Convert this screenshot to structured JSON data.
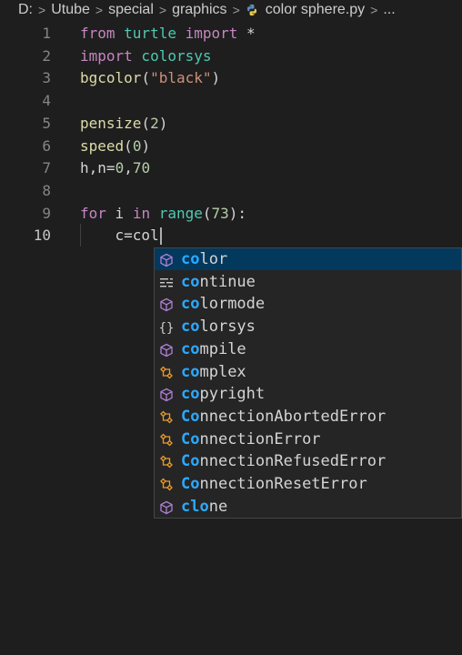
{
  "breadcrumb": {
    "items": [
      "D:",
      "Utube",
      "special",
      "graphics",
      "color sphere.py",
      "..."
    ]
  },
  "editor": {
    "lines": [
      {
        "num": "1",
        "tokens": [
          {
            "t": "from",
            "c": "kw"
          },
          {
            "t": " turtle ",
            "c": "mod"
          },
          {
            "t": "import",
            "c": "kw"
          },
          {
            "t": " *",
            "c": "plain"
          }
        ]
      },
      {
        "num": "2",
        "tokens": [
          {
            "t": "import",
            "c": "kw"
          },
          {
            "t": " colorsys",
            "c": "mod"
          }
        ]
      },
      {
        "num": "3",
        "tokens": [
          {
            "t": "bgcolor",
            "c": "fn"
          },
          {
            "t": "(",
            "c": "plain"
          },
          {
            "t": "\"black\"",
            "c": "str"
          },
          {
            "t": ")",
            "c": "plain"
          }
        ]
      },
      {
        "num": "4",
        "tokens": []
      },
      {
        "num": "5",
        "tokens": [
          {
            "t": "pensize",
            "c": "fn"
          },
          {
            "t": "(",
            "c": "plain"
          },
          {
            "t": "2",
            "c": "num"
          },
          {
            "t": ")",
            "c": "plain"
          }
        ]
      },
      {
        "num": "6",
        "tokens": [
          {
            "t": "speed",
            "c": "fn"
          },
          {
            "t": "(",
            "c": "plain"
          },
          {
            "t": "0",
            "c": "num"
          },
          {
            "t": ")",
            "c": "plain"
          }
        ]
      },
      {
        "num": "7",
        "tokens": [
          {
            "t": "h",
            "c": "plain"
          },
          {
            "t": ",",
            "c": "plain"
          },
          {
            "t": "n",
            "c": "plain"
          },
          {
            "t": "=",
            "c": "plain"
          },
          {
            "t": "0",
            "c": "num"
          },
          {
            "t": ",",
            "c": "plain"
          },
          {
            "t": "70",
            "c": "num"
          }
        ]
      },
      {
        "num": "8",
        "tokens": []
      },
      {
        "num": "9",
        "tokens": [
          {
            "t": "for",
            "c": "kw"
          },
          {
            "t": " i ",
            "c": "plain"
          },
          {
            "t": "in",
            "c": "kw"
          },
          {
            "t": " ",
            "c": "plain"
          },
          {
            "t": "range",
            "c": "mod"
          },
          {
            "t": "(",
            "c": "plain"
          },
          {
            "t": "73",
            "c": "num"
          },
          {
            "t": "):",
            "c": "plain"
          }
        ]
      },
      {
        "num": "10",
        "tokens": [
          {
            "t": "    c=col",
            "c": "plain"
          }
        ],
        "active": true,
        "cursor": true
      }
    ]
  },
  "suggestions": {
    "items": [
      {
        "label": "color",
        "match": "co",
        "kind": "cube-icon",
        "selected": true
      },
      {
        "label": "continue",
        "match": "co",
        "kind": "keyword-icon"
      },
      {
        "label": "colormode",
        "match": "co",
        "kind": "cube-icon"
      },
      {
        "label": "colorsys",
        "match": "co",
        "kind": "braces-icon"
      },
      {
        "label": "compile",
        "match": "co",
        "kind": "cube-icon"
      },
      {
        "label": "complex",
        "match": "co",
        "kind": "class-icon"
      },
      {
        "label": "copyright",
        "match": "co",
        "kind": "cube-icon"
      },
      {
        "label": "ConnectionAbortedError",
        "match": "Co",
        "kind": "class-icon"
      },
      {
        "label": "ConnectionError",
        "match": "Co",
        "kind": "class-icon"
      },
      {
        "label": "ConnectionRefusedError",
        "match": "Co",
        "kind": "class-icon"
      },
      {
        "label": "ConnectionResetError",
        "match": "Co",
        "kind": "class-icon"
      },
      {
        "label": "clone",
        "match": "clo",
        "kind": "cube-icon"
      }
    ]
  },
  "colors": {
    "keyword": "#c586c0",
    "module": "#4ec9b0",
    "function": "#dcdcaa",
    "string": "#ce9178",
    "number": "#b5cea8",
    "match": "#2aaaff",
    "selection": "#04395e"
  }
}
